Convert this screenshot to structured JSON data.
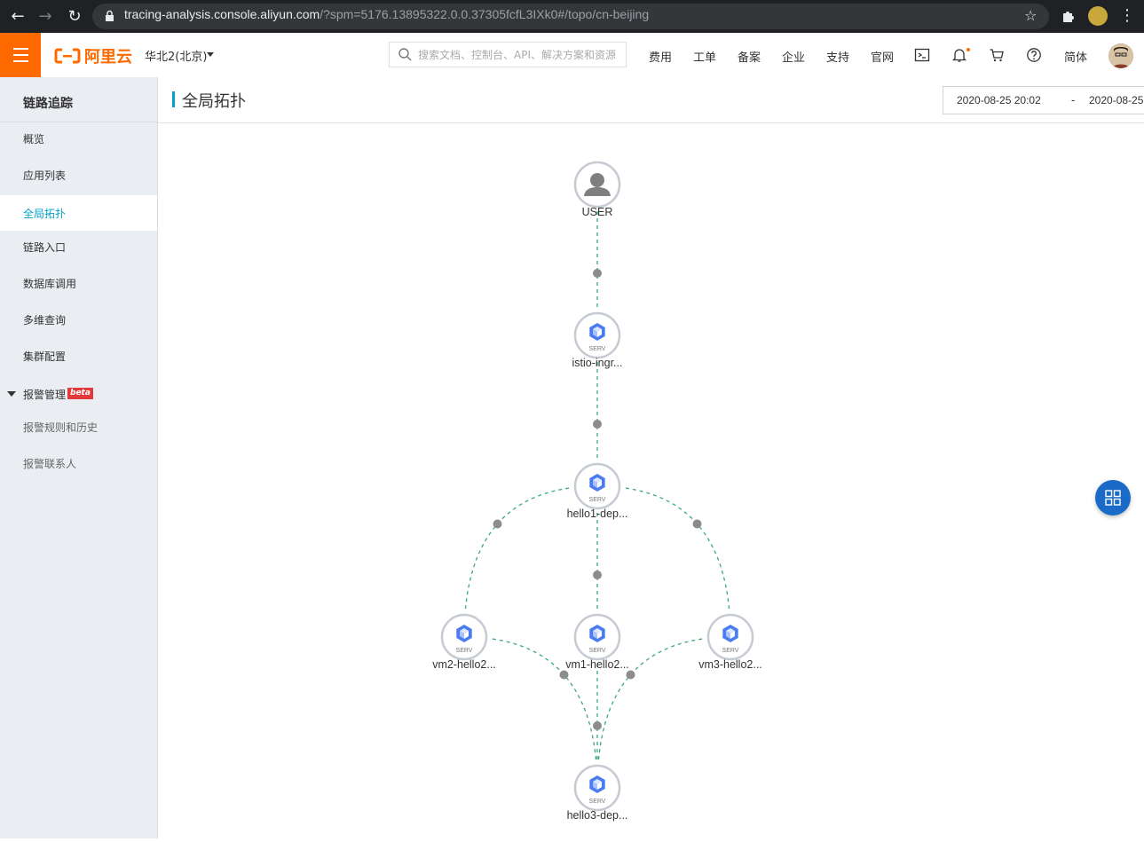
{
  "browser": {
    "url_host": "tracing-analysis.console.aliyun.com",
    "url_path": "/?spm=5176.13895322.0.0.37305fcfL3IXk0#/topo/cn-beijing"
  },
  "topnav": {
    "logo_text": "阿里云",
    "region": "华北2(北京)",
    "search_placeholder": "搜索文档、控制台、API、解决方案和资源",
    "links": [
      "费用",
      "工单",
      "备案",
      "企业",
      "支持",
      "官网"
    ],
    "language": "简体"
  },
  "sidebar": {
    "title": "链路追踪",
    "items": [
      "概览",
      "应用列表",
      "全局拓扑",
      "链路入口",
      "数据库调用",
      "多维查询",
      "集群配置"
    ],
    "active_item": "全局拓扑",
    "group": {
      "label": "报警管理",
      "badge": "beta",
      "children": [
        "报警规则和历史",
        "报警联系人"
      ]
    }
  },
  "page": {
    "title": "全局拓扑",
    "date_start": "2020-08-25 20:02",
    "date_separator": "-",
    "date_end": "2020-08-25"
  },
  "topology": {
    "service_tag": "SERV",
    "edge_color": "#3aa786",
    "nodes": [
      {
        "id": "user",
        "label": "USER",
        "kind": "user"
      },
      {
        "id": "istio",
        "label": "istio-ingr...",
        "kind": "service"
      },
      {
        "id": "hello1",
        "label": "hello1-dep...",
        "kind": "service"
      },
      {
        "id": "vm2",
        "label": "vm2-hello2...",
        "kind": "service"
      },
      {
        "id": "vm1",
        "label": "vm1-hello2...",
        "kind": "service"
      },
      {
        "id": "vm3",
        "label": "vm3-hello2...",
        "kind": "service"
      },
      {
        "id": "hello3",
        "label": "hello3-dep...",
        "kind": "service"
      }
    ],
    "edges": [
      [
        "user",
        "istio"
      ],
      [
        "istio",
        "hello1"
      ],
      [
        "hello1",
        "vm2"
      ],
      [
        "hello1",
        "vm1"
      ],
      [
        "hello1",
        "vm3"
      ],
      [
        "vm2",
        "hello3"
      ],
      [
        "vm1",
        "hello3"
      ],
      [
        "vm3",
        "hello3"
      ]
    ]
  }
}
